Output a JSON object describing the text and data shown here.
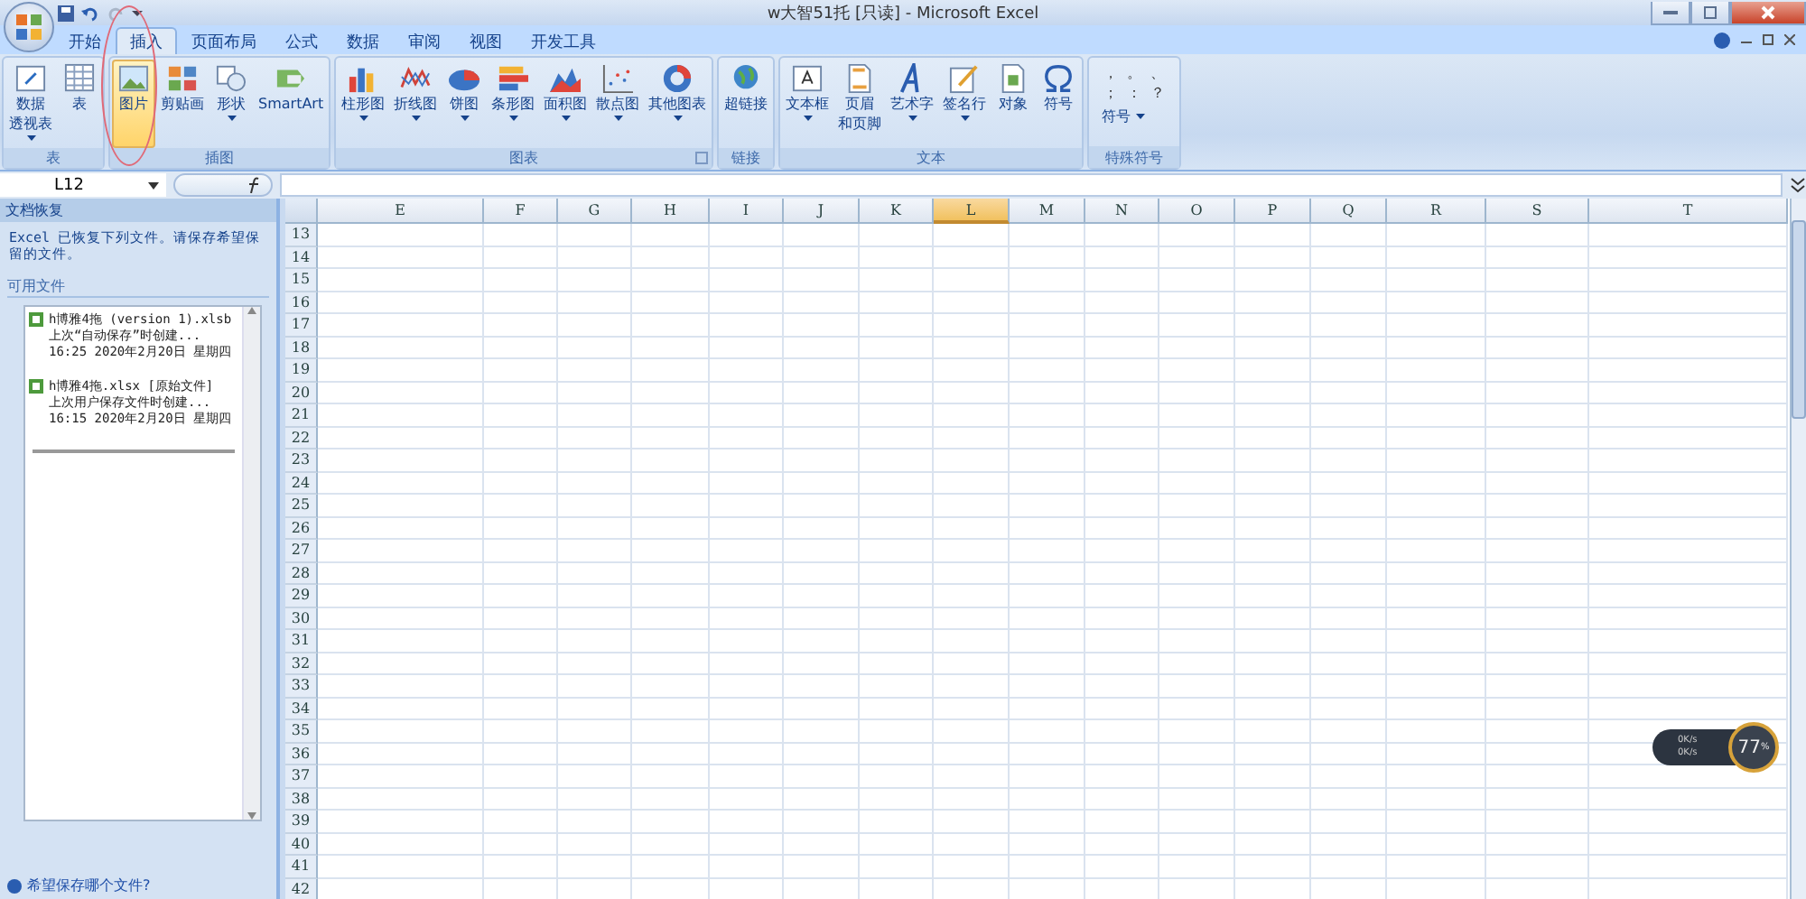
{
  "window": {
    "title": "w大智51托 [只读] - Microsoft Excel"
  },
  "tabs": [
    {
      "label": "开始",
      "selected": false
    },
    {
      "label": "插入",
      "selected": true
    },
    {
      "label": "页面布局",
      "selected": false
    },
    {
      "label": "公式",
      "selected": false
    },
    {
      "label": "数据",
      "selected": false
    },
    {
      "label": "审阅",
      "selected": false
    },
    {
      "label": "视图",
      "selected": false
    },
    {
      "label": "开发工具",
      "selected": false
    }
  ],
  "ribbon_groups": [
    {
      "label": "表",
      "launcher": false,
      "buttons": [
        {
          "kind": "pivot",
          "lines": [
            "数据",
            "透视表"
          ],
          "selected": false,
          "dropdown": true
        },
        {
          "kind": "table",
          "lines": [
            "表"
          ],
          "selected": false,
          "dropdown": false
        }
      ]
    },
    {
      "label": "插图",
      "launcher": false,
      "buttons": [
        {
          "kind": "picture",
          "lines": [
            "图片"
          ],
          "selected": true,
          "dropdown": false
        },
        {
          "kind": "clipart",
          "lines": [
            "剪贴画"
          ],
          "selected": false,
          "dropdown": false
        },
        {
          "kind": "shapes",
          "lines": [
            "形状"
          ],
          "selected": false,
          "dropdown": true
        },
        {
          "kind": "smartart",
          "lines": [
            "SmartArt"
          ],
          "selected": false,
          "dropdown": false
        }
      ]
    },
    {
      "label": "图表",
      "launcher": true,
      "buttons": [
        {
          "kind": "column",
          "lines": [
            "柱形图"
          ],
          "selected": false,
          "dropdown": true
        },
        {
          "kind": "line",
          "lines": [
            "折线图"
          ],
          "selected": false,
          "dropdown": true
        },
        {
          "kind": "pie",
          "lines": [
            "饼图"
          ],
          "selected": false,
          "dropdown": true
        },
        {
          "kind": "bar",
          "lines": [
            "条形图"
          ],
          "selected": false,
          "dropdown": true
        },
        {
          "kind": "area",
          "lines": [
            "面积图"
          ],
          "selected": false,
          "dropdown": true
        },
        {
          "kind": "scatter",
          "lines": [
            "散点图"
          ],
          "selected": false,
          "dropdown": true
        },
        {
          "kind": "donut",
          "lines": [
            "其他图表"
          ],
          "selected": false,
          "dropdown": true
        }
      ]
    },
    {
      "label": "链接",
      "launcher": false,
      "buttons": [
        {
          "kind": "globe",
          "lines": [
            "超链接"
          ],
          "selected": false,
          "dropdown": false
        }
      ]
    },
    {
      "label": "文本",
      "launcher": false,
      "buttons": [
        {
          "kind": "textbox",
          "lines": [
            "文本框"
          ],
          "selected": false,
          "dropdown": true
        },
        {
          "kind": "header",
          "lines": [
            "页眉",
            "和页脚"
          ],
          "selected": false,
          "dropdown": false
        },
        {
          "kind": "wordart",
          "lines": [
            "艺术字"
          ],
          "selected": false,
          "dropdown": true
        },
        {
          "kind": "signature",
          "lines": [
            "签名行"
          ],
          "selected": false,
          "dropdown": true
        },
        {
          "kind": "object",
          "lines": [
            "对象"
          ],
          "selected": false,
          "dropdown": false
        },
        {
          "kind": "omega",
          "lines": [
            "符号"
          ],
          "selected": false,
          "dropdown": false
        }
      ]
    },
    {
      "label": "特殊符号",
      "launcher": false,
      "symbols": [
        "，",
        "。",
        "、",
        "；",
        "：",
        "？"
      ],
      "symbol_button": "符号"
    }
  ],
  "formula_bar": {
    "name_box": "L12"
  },
  "task_pane": {
    "title": "文档恢复",
    "message": "Excel 已恢复下列文件。请保存希望保留的文件。",
    "section": "可用文件",
    "files": [
      {
        "name": "h博雅4拖 (version 1).xlsb",
        "note": "上次“自动保存”时创建...",
        "time": "16:25 2020年2月20日 星期四"
      },
      {
        "name": "h博雅4拖.xlsx  [原始文件]",
        "note": "上次用户保存文件时创建...",
        "time": "16:15 2020年2月20日 星期四"
      }
    ],
    "link": "希望保存哪个文件?"
  },
  "sheet": {
    "columns": [
      {
        "label": "E",
        "selected": false
      },
      {
        "label": "F",
        "selected": false
      },
      {
        "label": "G",
        "selected": false
      },
      {
        "label": "H",
        "selected": false
      },
      {
        "label": "I",
        "selected": false
      },
      {
        "label": "J",
        "selected": false
      },
      {
        "label": "K",
        "selected": false
      },
      {
        "label": "L",
        "selected": true
      },
      {
        "label": "M",
        "selected": false
      },
      {
        "label": "N",
        "selected": false
      },
      {
        "label": "O",
        "selected": false
      },
      {
        "label": "P",
        "selected": false
      },
      {
        "label": "Q",
        "selected": false
      },
      {
        "label": "R",
        "selected": false
      },
      {
        "label": "S",
        "selected": false
      },
      {
        "label": "T",
        "selected": false
      }
    ],
    "rows": [
      "13",
      "14",
      "15",
      "16",
      "17",
      "18",
      "19",
      "20",
      "21",
      "22",
      "23",
      "24",
      "25",
      "26",
      "27",
      "28",
      "29",
      "30",
      "31",
      "32",
      "33",
      "34",
      "35",
      "36",
      "37",
      "38",
      "39",
      "40",
      "41",
      "42"
    ]
  },
  "net_widget": {
    "upload": "0K/s",
    "download": "0K/s",
    "percent": "77",
    "unit": "%"
  }
}
